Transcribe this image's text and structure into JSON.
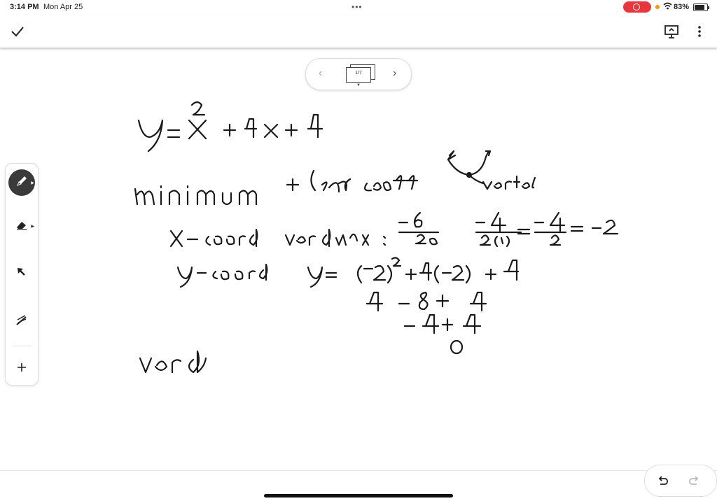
{
  "status_bar": {
    "time": "3:14 PM",
    "date": "Mon Apr 25",
    "battery": "83%",
    "recording_color": "#e8373c"
  },
  "toolbar": {
    "done_icon": "check-icon",
    "present_icon": "present-icon",
    "more_icon": "more-vertical-icon"
  },
  "page_nav": {
    "indicator": "1/7",
    "prev_icon": "chevron-left-icon",
    "next_icon": "chevron-right-icon"
  },
  "tools": [
    {
      "name": "pen",
      "icon": "pen-icon",
      "active": true
    },
    {
      "name": "eraser",
      "icon": "eraser-icon",
      "active": false
    },
    {
      "name": "select",
      "icon": "select-arrow-icon",
      "active": false
    },
    {
      "name": "laser",
      "icon": "laser-pointer-icon",
      "active": false
    },
    {
      "name": "add",
      "icon": "plus-icon",
      "active": false
    }
  ],
  "ink_color": "#1a1a1a",
  "notes": {
    "line1": "y = x² + 4x + 4",
    "line2": "minimum",
    "line3": "+ lead coeff",
    "diagram_label": "vertex",
    "line4_label": "x-coord vertex:",
    "line4_expr1": "−b / 2a",
    "line4_expr2": "−4 / 2(1) = −4 / 2 = −2",
    "line5_label": "y-coord",
    "line5_expr": "y = (−2)² + 4(−2) + 4",
    "line6": "4 − 8 + 4",
    "line7": "−4 + 4",
    "line8": "0",
    "line9": "verd"
  },
  "undo_icon": "undo-icon",
  "redo_icon": "redo-icon"
}
